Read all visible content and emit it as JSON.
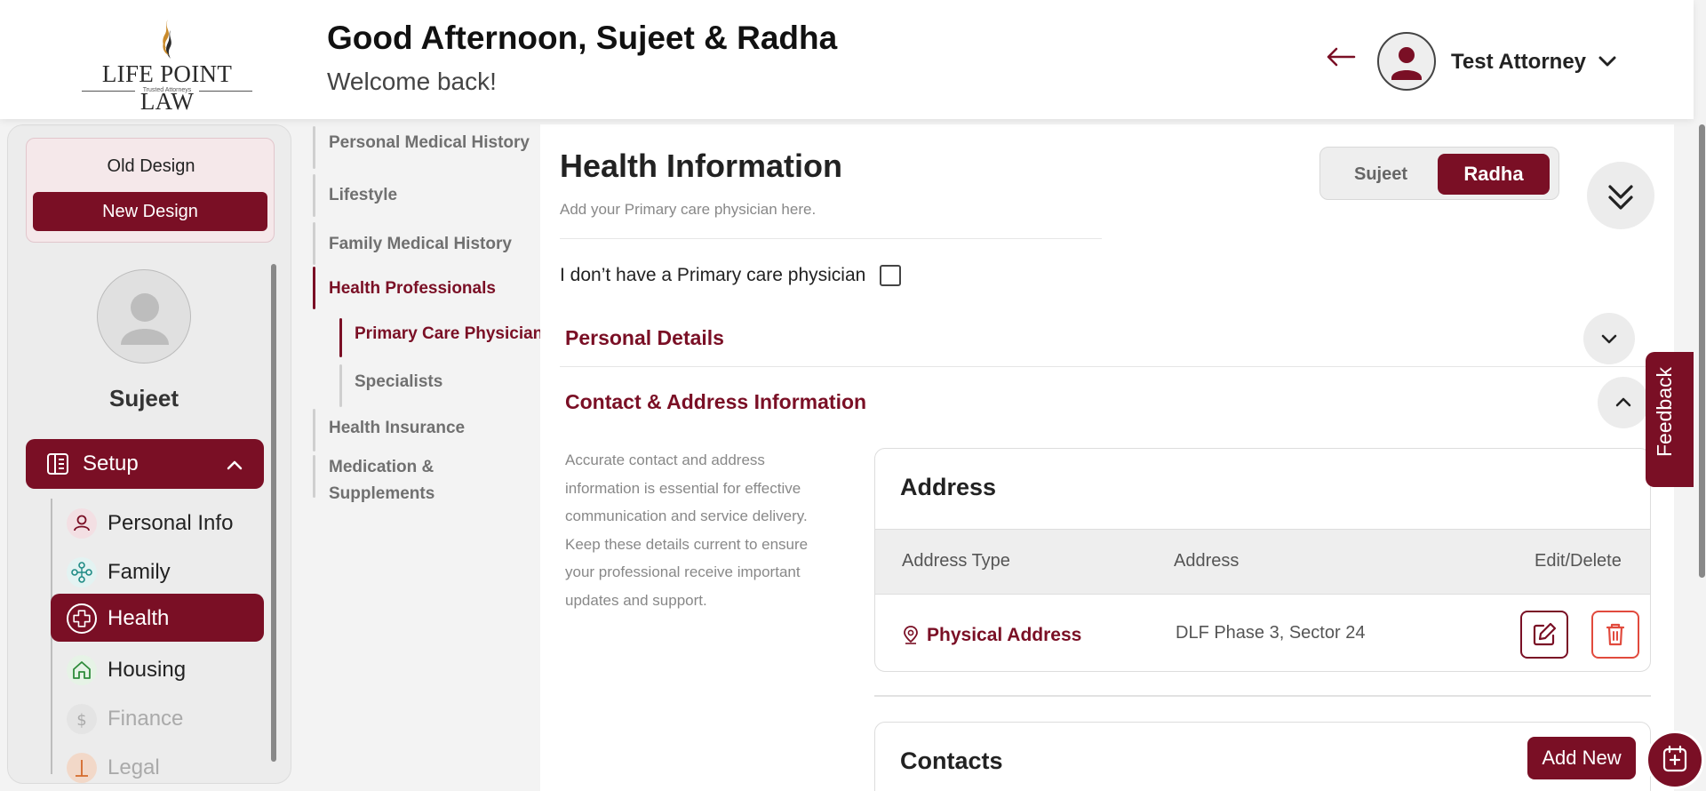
{
  "header": {
    "logo_text": "LIFE POINT LAW",
    "logo_tagline": "Trusted Attorneys",
    "greeting": "Good Afternoon, Sujeet & Radha",
    "welcome": "Welcome back!",
    "user_name": "Test Attorney",
    "back_icon": "arrow-left-icon",
    "dropdown_icon": "chevron-down-icon"
  },
  "sidebar": {
    "old_design": "Old Design",
    "new_design": "New Design",
    "profile_name": "Sujeet",
    "setup_label": "Setup",
    "items": [
      {
        "label": "Personal Info",
        "icon": "person-icon",
        "state": "normal"
      },
      {
        "label": "Family",
        "icon": "family-icon",
        "state": "normal"
      },
      {
        "label": "Health",
        "icon": "health-cross-icon",
        "state": "active"
      },
      {
        "label": "Housing",
        "icon": "home-icon",
        "state": "normal"
      },
      {
        "label": "Finance",
        "icon": "dollar-icon",
        "state": "disabled"
      },
      {
        "label": "Legal",
        "icon": "legal-icon",
        "state": "disabled"
      }
    ]
  },
  "subnav": {
    "items": [
      {
        "label": "Personal Medical History"
      },
      {
        "label": "Lifestyle"
      },
      {
        "label": "Family Medical History"
      },
      {
        "label": "Health Professionals"
      },
      {
        "label": "Primary Care Physician"
      },
      {
        "label": "Specialists"
      },
      {
        "label": "Health Insurance"
      },
      {
        "label": "Medication &"
      },
      {
        "label": "Supplements"
      }
    ]
  },
  "main": {
    "title": "Health Information",
    "subtitle": "Add your Primary care physician here.",
    "toggle": [
      "Sujeet",
      "Radha"
    ],
    "toggle_selected": "Radha",
    "no_pcp_label": "I don’t have a Primary care physician",
    "no_pcp_checked": false,
    "sections": {
      "personal_details": "Personal Details",
      "contact_address": "Contact & Address Information"
    },
    "contact_description": "Accurate contact and address information is essential for effective communication and service delivery. Keep these details current to ensure your professional receive important updates and support.",
    "address": {
      "title": "Address",
      "columns": [
        "Address Type",
        "Address",
        "Edit/Delete"
      ],
      "rows": [
        {
          "type": "Physical Address",
          "address": "DLF Phase 3, Sector 24"
        }
      ]
    },
    "contacts": {
      "title": "Contacts",
      "add_new": "Add New"
    }
  },
  "feedback_label": "Feedback",
  "colors": {
    "accent": "#7a0f25",
    "delete": "#e14a3d"
  }
}
